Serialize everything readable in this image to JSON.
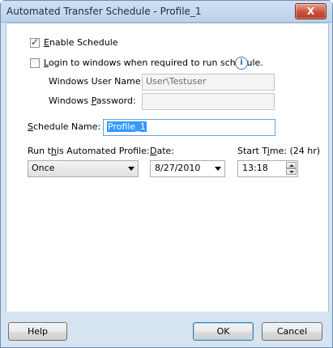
{
  "window": {
    "title": "Automated Transfer Schedule - Profile_1",
    "close_glyph": "X"
  },
  "enable_schedule": {
    "label_underlined": "E",
    "label_rest": "nable Schedule",
    "checked": true
  },
  "login_windows": {
    "label_underlined": "L",
    "label_rest": "ogin to windows when required to run schedule.",
    "checked": false,
    "info_glyph": "i"
  },
  "windows_user": {
    "label": "Windows User Name:",
    "value": "User\\Testuser"
  },
  "windows_password": {
    "label_prefix": "Windows ",
    "label_underlined": "P",
    "label_rest": "assword:",
    "value": ""
  },
  "schedule_name": {
    "label_underlined": "S",
    "label_rest": "chedule Name:",
    "value": "Profile_1"
  },
  "run_profile": {
    "label_prefix": "Run t",
    "label_underlined": "h",
    "label_rest": "is Automated Profile:",
    "selected": "Once"
  },
  "date": {
    "label_underlined": "D",
    "label_rest": "ate:",
    "value": "8/27/2010"
  },
  "start_time": {
    "label_prefix": "Start T",
    "label_underlined": "i",
    "label_rest": "me: (24 hr)",
    "value": "13:18"
  },
  "buttons": {
    "help": "Help",
    "ok": "OK",
    "cancel": "Cancel"
  }
}
